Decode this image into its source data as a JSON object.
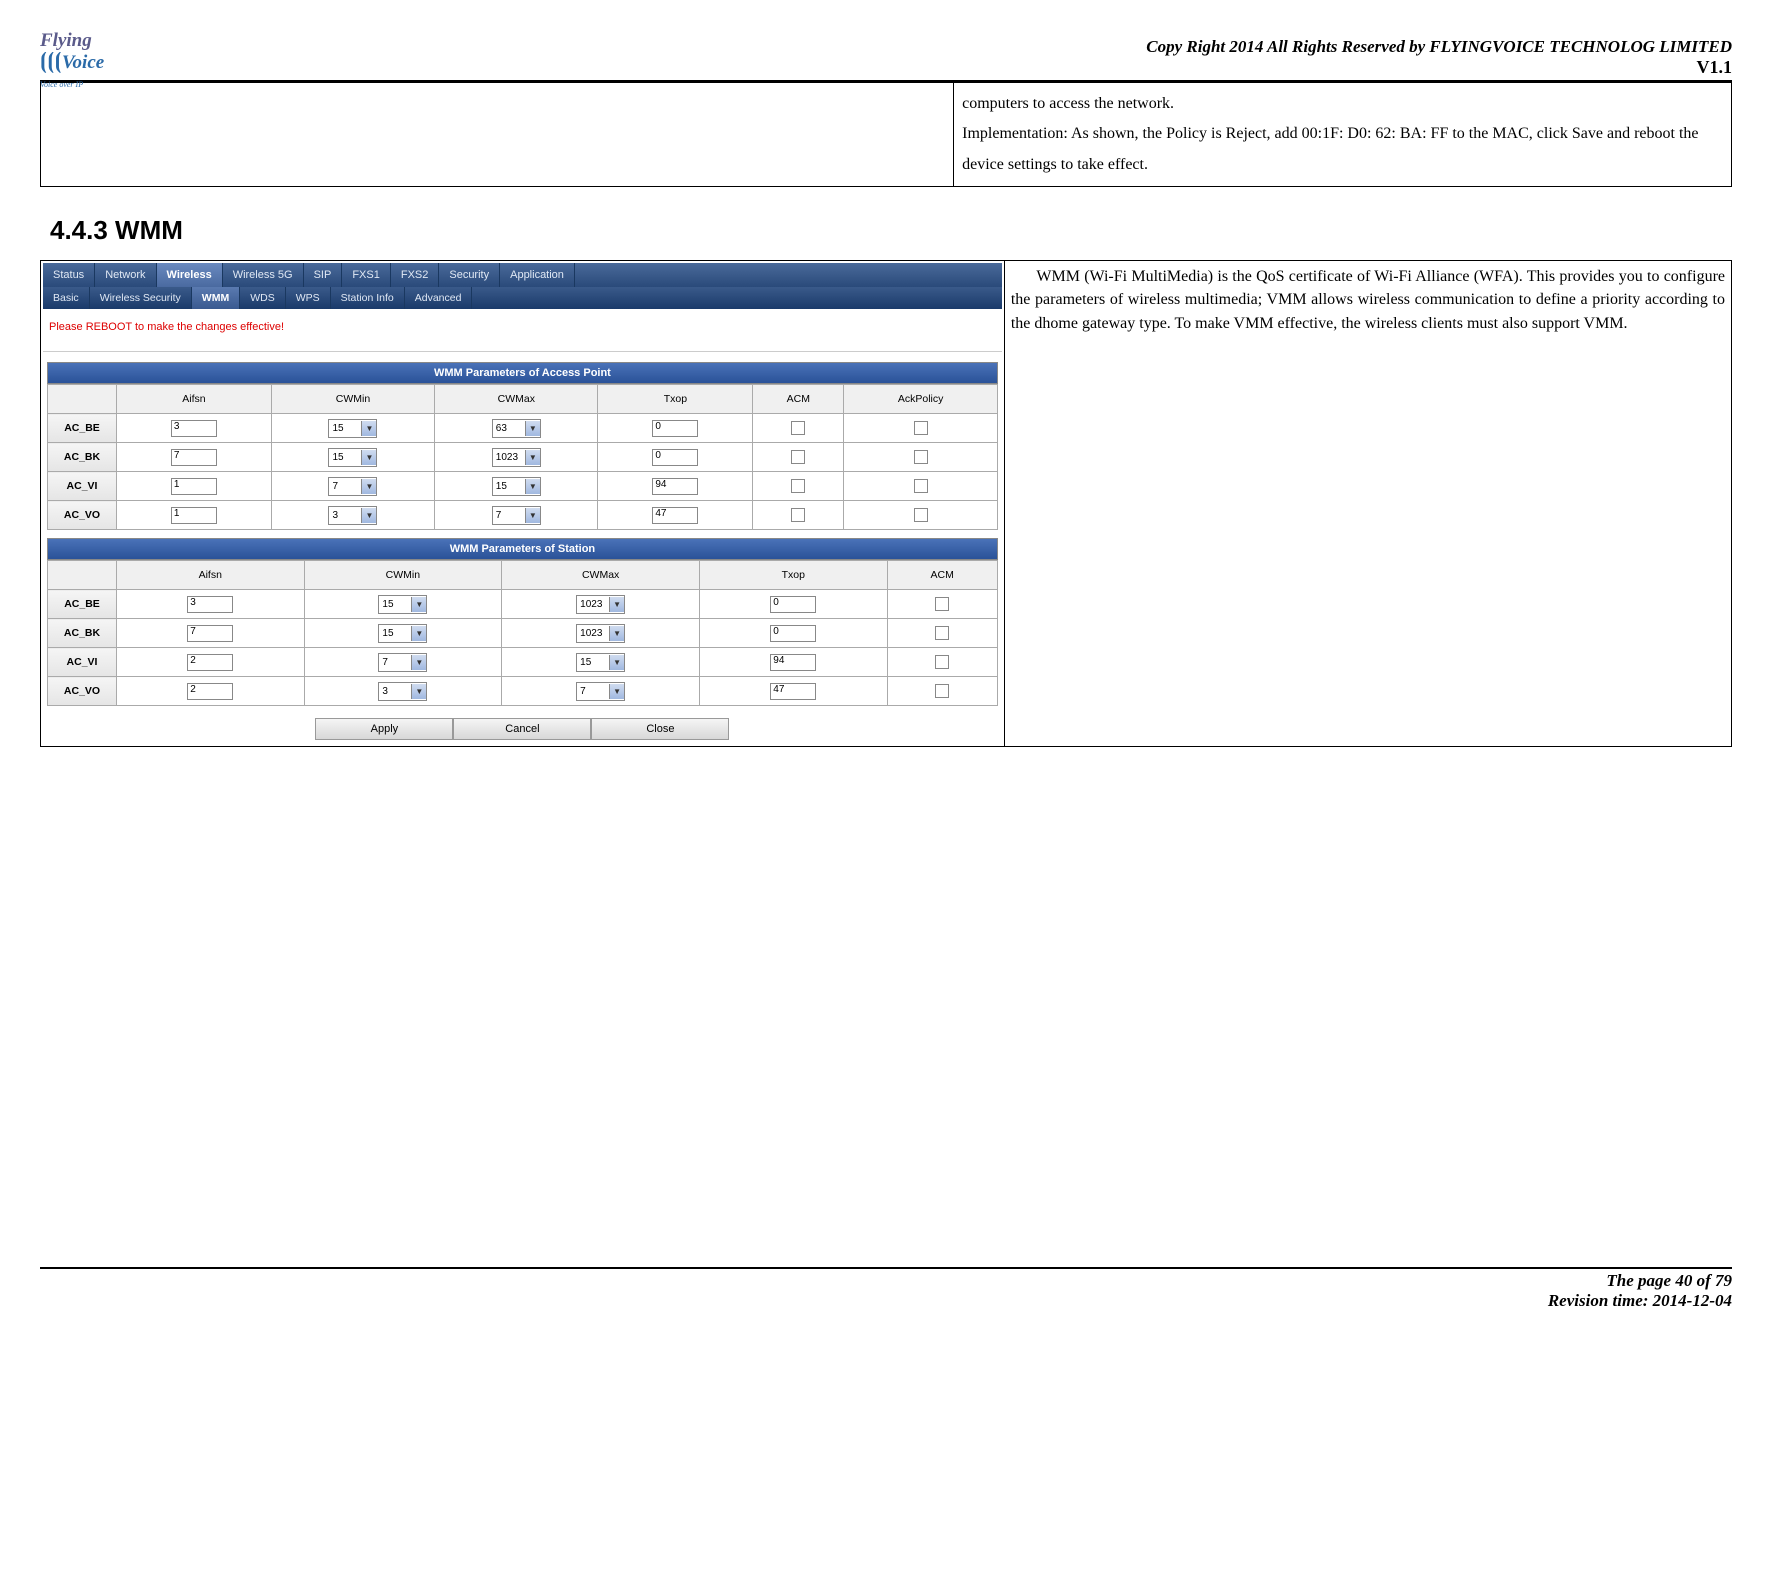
{
  "header": {
    "logo_top": "Flying",
    "logo_bottom": "Voice",
    "logo_sub": "Voice over IP",
    "copyright": "Copy Right 2014 All Rights Reserved by FLYINGVOICE TECHNOLOG LIMITED",
    "version": "V1.1"
  },
  "desc_box": {
    "text": "computers to access the network.\nImplementation: As shown, the Policy is Reject, add 00:1F: D0: 62: BA: FF to the MAC, click Save and reboot the device settings to take effect."
  },
  "section_title": "4.4.3 WMM",
  "screenshot": {
    "main_tabs": [
      "Status",
      "Network",
      "Wireless",
      "Wireless 5G",
      "SIP",
      "FXS1",
      "FXS2",
      "Security",
      "Application"
    ],
    "main_active": "Wireless",
    "sub_tabs": [
      "Basic",
      "Wireless Security",
      "WMM",
      "WDS",
      "WPS",
      "Station Info",
      "Advanced"
    ],
    "sub_active": "WMM",
    "reboot_msg": "Please REBOOT to make the changes effective!",
    "ap_title": "WMM Parameters of Access Point",
    "ap_headers": [
      "",
      "Aifsn",
      "CWMin",
      "CWMax",
      "Txop",
      "ACM",
      "AckPolicy"
    ],
    "ap_rows": [
      {
        "name": "AC_BE",
        "aifsn": "3",
        "cwmin": "15",
        "cwmax": "63",
        "txop": "0"
      },
      {
        "name": "AC_BK",
        "aifsn": "7",
        "cwmin": "15",
        "cwmax": "1023",
        "txop": "0"
      },
      {
        "name": "AC_VI",
        "aifsn": "1",
        "cwmin": "7",
        "cwmax": "15",
        "txop": "94"
      },
      {
        "name": "AC_VO",
        "aifsn": "1",
        "cwmin": "3",
        "cwmax": "7",
        "txop": "47"
      }
    ],
    "sta_title": "WMM Parameters of Station",
    "sta_headers": [
      "",
      "Aifsn",
      "CWMin",
      "CWMax",
      "Txop",
      "ACM"
    ],
    "sta_rows": [
      {
        "name": "AC_BE",
        "aifsn": "3",
        "cwmin": "15",
        "cwmax": "1023",
        "txop": "0"
      },
      {
        "name": "AC_BK",
        "aifsn": "7",
        "cwmin": "15",
        "cwmax": "1023",
        "txop": "0"
      },
      {
        "name": "AC_VI",
        "aifsn": "2",
        "cwmin": "7",
        "cwmax": "15",
        "txop": "94"
      },
      {
        "name": "AC_VO",
        "aifsn": "2",
        "cwmin": "3",
        "cwmax": "7",
        "txop": "47"
      }
    ],
    "buttons": [
      "Apply",
      "Cancel",
      "Close"
    ]
  },
  "wmm_desc": "      WMM (Wi-Fi MultiMedia) is the QoS certificate of Wi-Fi Alliance (WFA). This provides you to configure the parameters of wireless multimedia; VMM allows wireless communication to define a priority according to the dhome gateway type. To make VMM effective, the wireless clients must also support VMM.",
  "footer": {
    "page": "The page 40 of 79",
    "revision": "Revision time: 2014-12-04"
  }
}
